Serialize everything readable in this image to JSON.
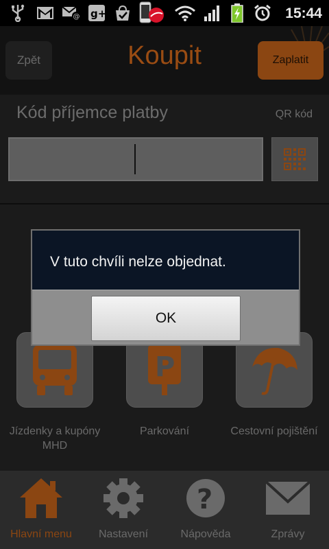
{
  "status_bar": {
    "time": "15:44",
    "icons": [
      "usb-icon",
      "gmail-icon",
      "email-icon",
      "google-plus-icon",
      "shopping-bag-icon",
      "phone-app-icon",
      "wifi-icon",
      "signal-icon",
      "battery-charging-icon",
      "alarm-icon"
    ]
  },
  "header": {
    "back_label": "Zpět",
    "title": "Koupit",
    "pay_label": "Zaplatit"
  },
  "recipient": {
    "label": "Kód příjemce platby",
    "qr_label": "QR kód",
    "input_value": "",
    "input_placeholder": ""
  },
  "tiles": [
    {
      "label_line1": "Jízdenky a kupóny",
      "label_line2": "MHD",
      "icon": "bus-icon"
    },
    {
      "label_line1": "Parkování",
      "label_line2": "",
      "icon": "parking-icon"
    },
    {
      "label_line1": "Cestovní pojištění",
      "label_line2": "",
      "icon": "umbrella-icon"
    }
  ],
  "bottom_nav": [
    {
      "label": "Hlavní menu",
      "icon": "home-icon",
      "active": true
    },
    {
      "label": "Nastavení",
      "icon": "gear-icon",
      "active": false
    },
    {
      "label": "Nápověda",
      "icon": "help-icon",
      "active": false
    },
    {
      "label": "Zprávy",
      "icon": "mail-icon",
      "active": false
    }
  ],
  "dialog": {
    "message": "V tuto chvíli nelze objednat.",
    "ok_label": "OK"
  },
  "colors": {
    "accent": "#8b4612",
    "dialog_bg": "#0b1525"
  }
}
